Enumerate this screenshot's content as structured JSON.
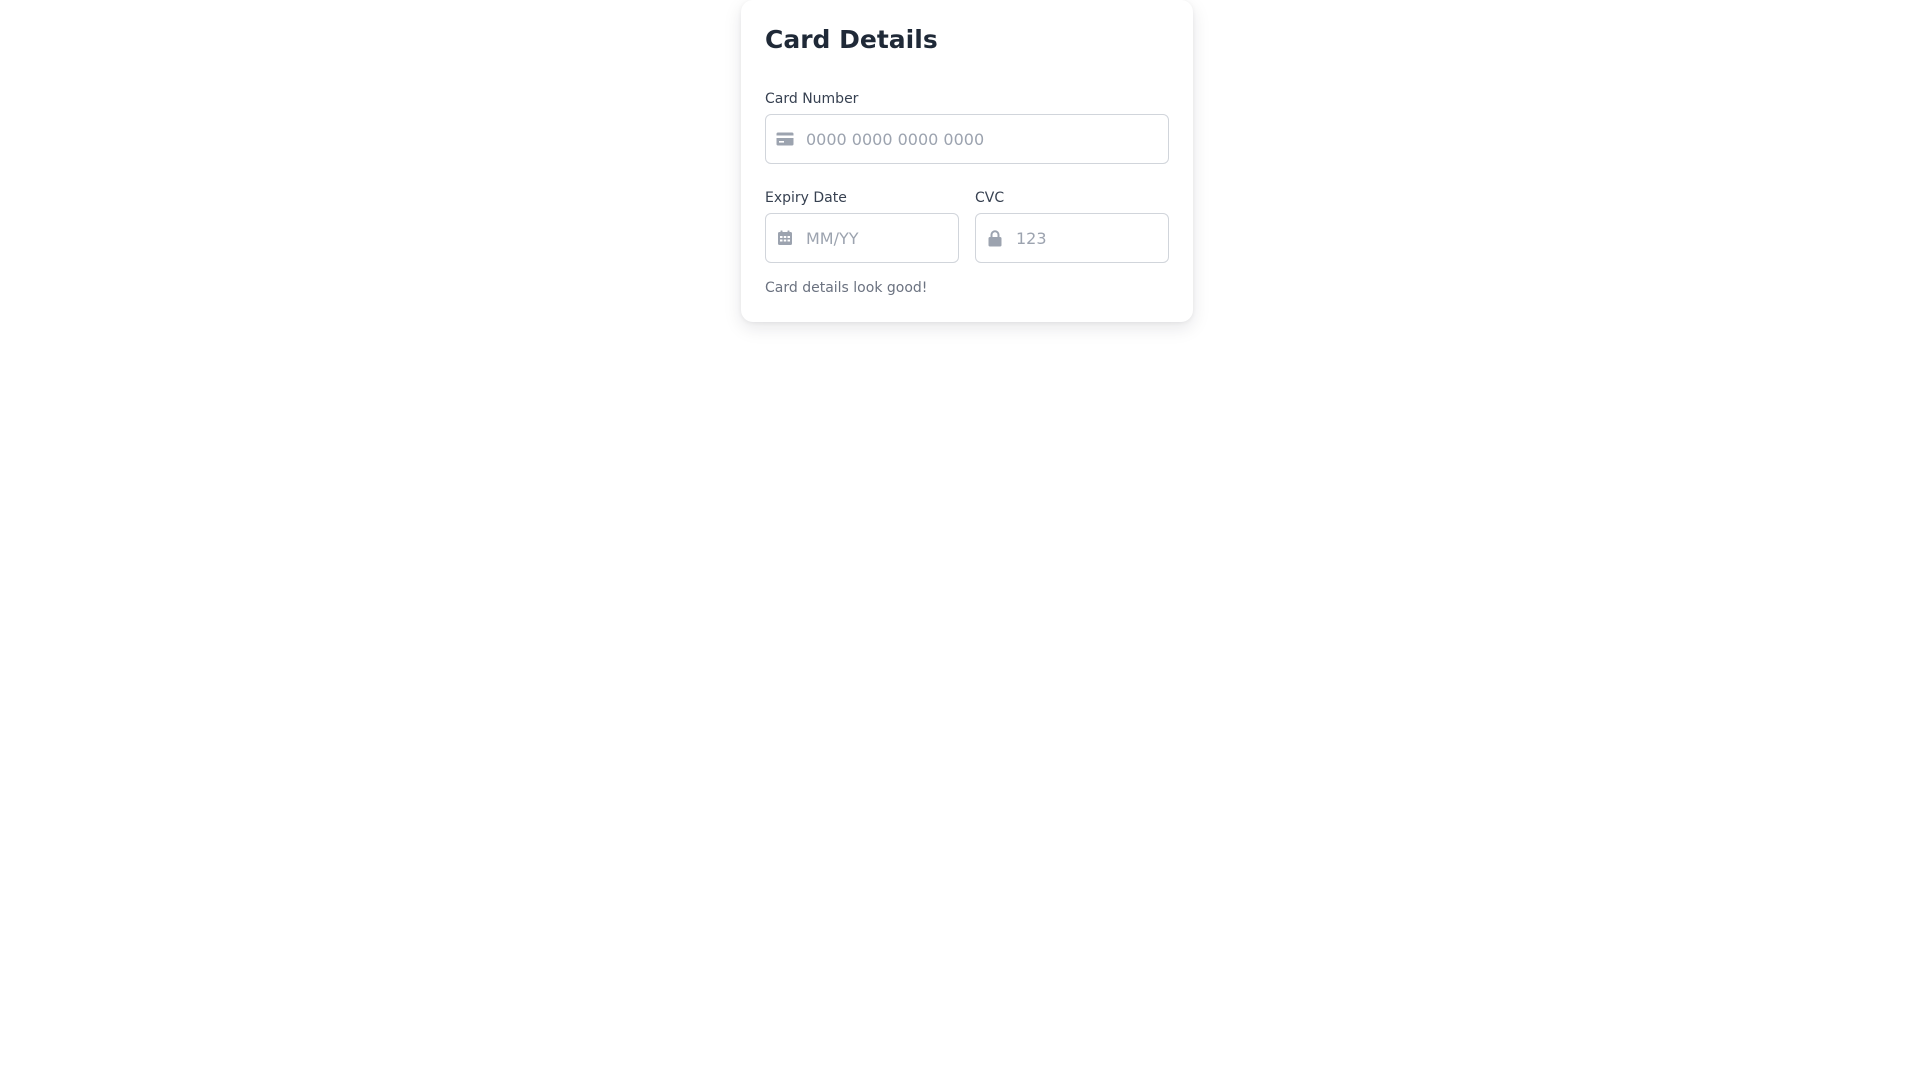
{
  "card": {
    "title": "Card Details",
    "card_number": {
      "label": "Card Number",
      "placeholder": "0000 0000 0000 0000",
      "value": "",
      "icon": "credit-card-icon"
    },
    "expiry": {
      "label": "Expiry Date",
      "placeholder": "MM/YY",
      "value": "",
      "icon": "calendar-icon"
    },
    "cvc": {
      "label": "CVC",
      "placeholder": "123",
      "value": "",
      "icon": "lock-icon"
    },
    "status_message": "Card details look good!"
  },
  "colors": {
    "title": "#1f2937",
    "label": "#374151",
    "placeholder": "#9ca3af",
    "icon": "#9ca3af",
    "border": "#d1d5db",
    "status": "#6b7280"
  }
}
